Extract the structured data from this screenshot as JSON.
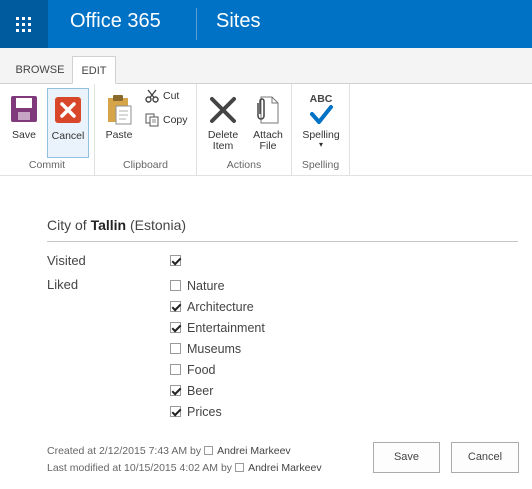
{
  "suite": {
    "brand": "Office 365",
    "site": "Sites"
  },
  "ribbon": {
    "tabs": [
      "BROWSE",
      "EDIT"
    ],
    "commit": {
      "save": "Save",
      "cancel": "Cancel",
      "label": "Commit"
    },
    "clipboard": {
      "paste": "Paste",
      "cut": "Cut",
      "copy": "Copy",
      "label": "Clipboard"
    },
    "actions": {
      "delete_line1": "Delete",
      "delete_line2": "Item",
      "attach_line1": "Attach",
      "attach_line2": "File",
      "label": "Actions"
    },
    "spelling": {
      "abc": "ABC",
      "button": "Spelling",
      "label": "Spelling"
    }
  },
  "form": {
    "title_prefix": "City of",
    "city": "Tallin",
    "country": "(Estonia)",
    "visited_label": "Visited",
    "visited": true,
    "liked_label": "Liked",
    "liked": [
      {
        "label": "Nature",
        "checked": false
      },
      {
        "label": "Architecture",
        "checked": true
      },
      {
        "label": "Entertainment",
        "checked": true
      },
      {
        "label": "Museums",
        "checked": false
      },
      {
        "label": "Food",
        "checked": false
      },
      {
        "label": "Beer",
        "checked": true
      },
      {
        "label": "Prices",
        "checked": true
      }
    ]
  },
  "footer": {
    "created": "Created at 2/12/2015 7:43 AM",
    "modified": "Last modified at 10/15/2015 4:02 AM",
    "by": "by",
    "author": "Andrei Markeev",
    "editor": "Andrei Markeev",
    "save": "Save",
    "cancel": "Cancel"
  },
  "colors": {
    "suitebar": "#0072c6",
    "waffle": "#005a9e",
    "cancel_red": "#d9472b",
    "save_purple": "#80397b"
  },
  "icons": [
    "app-launcher-icon",
    "save-icon",
    "cancel-icon",
    "paste-icon",
    "cut-icon",
    "copy-icon",
    "delete-icon",
    "attach-icon",
    "spelling-icon",
    "presence-icon"
  ]
}
